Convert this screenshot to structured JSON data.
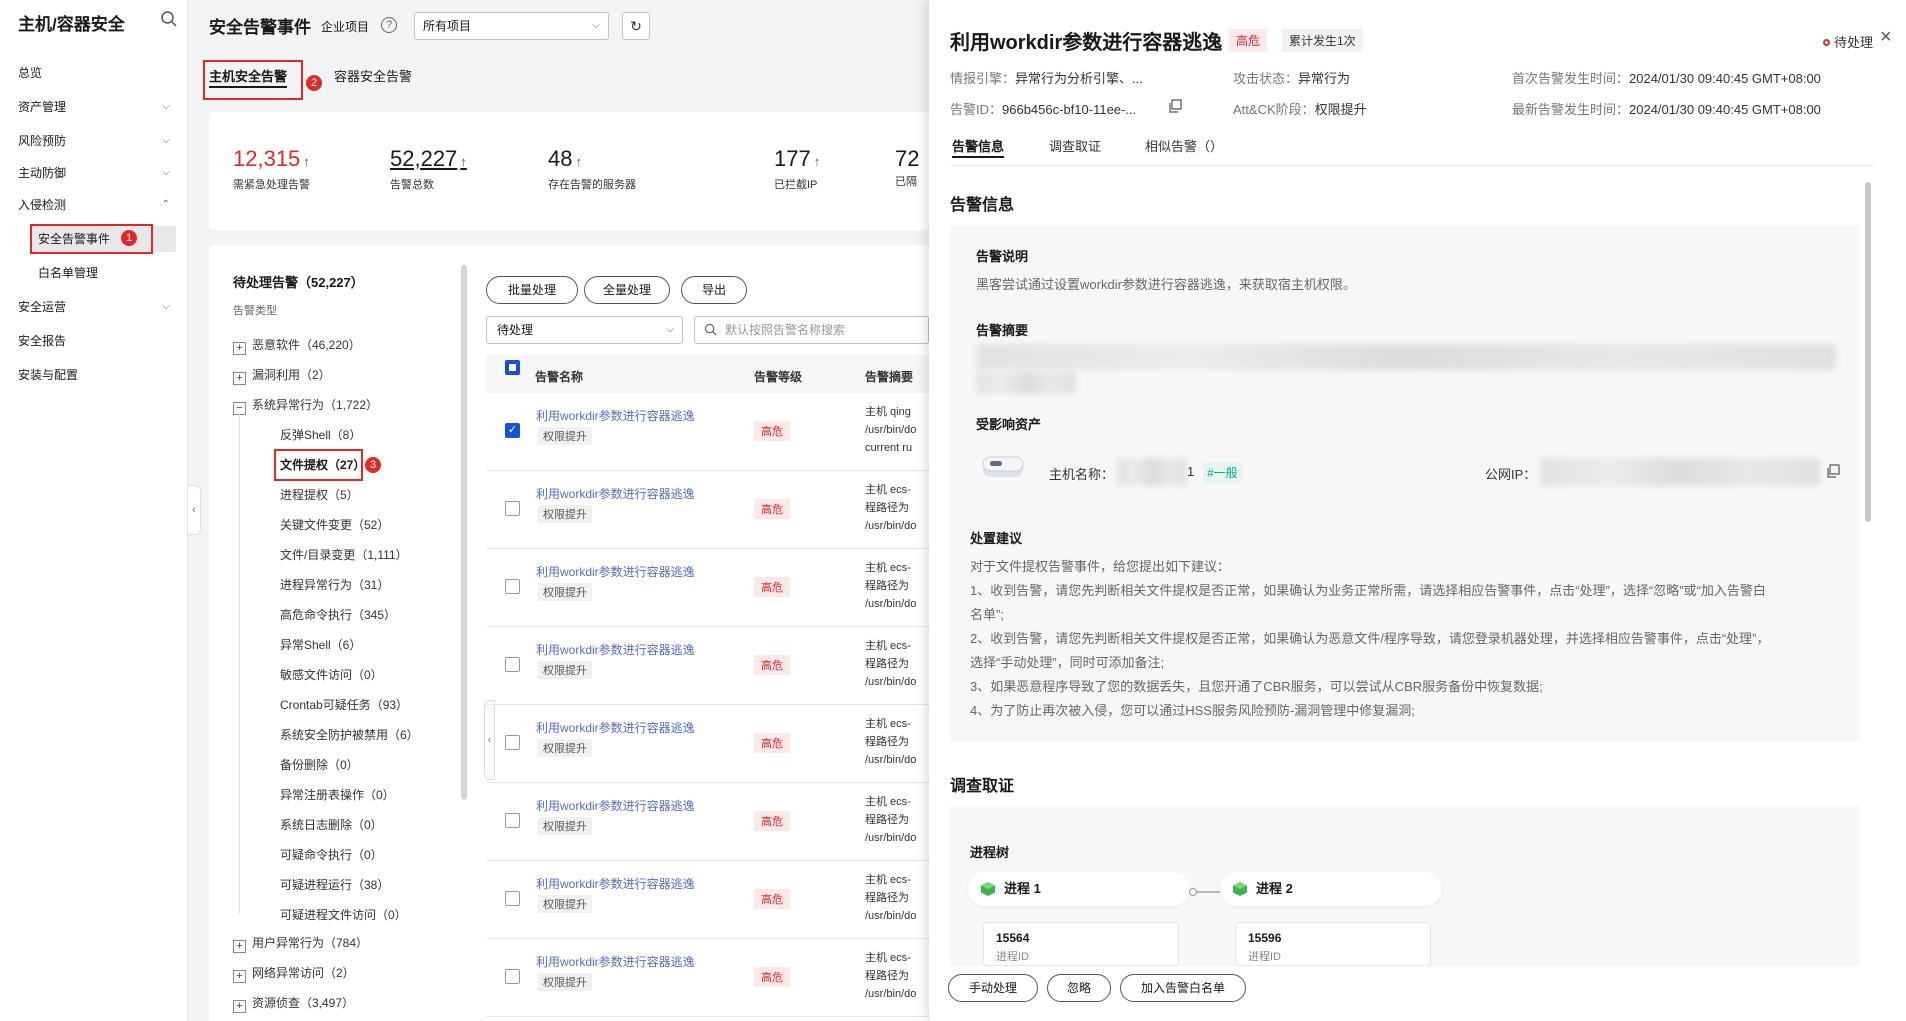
{
  "nav": {
    "title": "主机/容器安全",
    "items": [
      {
        "label": "总览"
      },
      {
        "label": "资产管理"
      },
      {
        "label": "风险预防"
      },
      {
        "label": "主动防御"
      },
      {
        "label": "入侵检测"
      },
      {
        "label": "安全告警事件"
      },
      {
        "label": "白名单管理"
      },
      {
        "label": "安全运营"
      },
      {
        "label": "安全报告"
      },
      {
        "label": "安装与配置"
      }
    ],
    "badges": [
      "1",
      "2",
      "3"
    ]
  },
  "header": {
    "title": "安全告警事件",
    "enterprise_label": "企业项目",
    "project_value": "所有项目"
  },
  "tabs": [
    "主机安全告警",
    "容器安全告警"
  ],
  "stats": [
    {
      "value": "12,315",
      "label": "需紧急处理告警",
      "color": "#e02828"
    },
    {
      "value": "52,227",
      "label": "告警总数"
    },
    {
      "value": "48",
      "label": "存在告警的服务器"
    },
    {
      "value": "177",
      "label": "已拦截IP"
    },
    {
      "value": "72",
      "label": "已隔"
    }
  ],
  "tree": {
    "title": "待处理告警（52,227）",
    "subtitle": "告警类型",
    "groups": [
      {
        "label": "恶意软件（46,220）",
        "expander": "+"
      },
      {
        "label": "漏洞利用（2）",
        "expander": "+"
      },
      {
        "label": "系统异常行为（1,722）",
        "expander": "−"
      }
    ],
    "children": [
      "反弹Shell（8）",
      "文件提权（27）",
      "进程提权（5）",
      "关键文件变更（52）",
      "文件/目录变更（1,111）",
      "进程异常行为（31）",
      "高危命令执行（345）",
      "异常Shell（6）",
      "敏感文件访问（0）",
      "Crontab可疑任务（93）",
      "系统安全防护被禁用（6）",
      "备份删除（0）",
      "异常注册表操作（0）",
      "系统日志删除（0）",
      "可疑命令执行（0）",
      "可疑进程运行（38）",
      "可疑进程文件访问（0）"
    ],
    "groups_after": [
      {
        "label": "用户异常行为（784）",
        "expander": "+"
      },
      {
        "label": "网络异常访问（2）",
        "expander": "+"
      },
      {
        "label": "资源侦查（3,497）",
        "expander": "+"
      }
    ]
  },
  "toolbar": {
    "batch": "批量处理",
    "all": "全量处理",
    "export": "导出",
    "status_value": "待处理",
    "search_placeholder": "默认按照告警名称搜索"
  },
  "table": {
    "headers": [
      "告警名称",
      "告警等级",
      "告警摘要"
    ],
    "rows": [
      {
        "name": "利用workdir参数进行容器逃逸",
        "tag": "权限提升",
        "level": "高危",
        "summary": "主机 qing\n/usr/bin/do\ncurrent ru",
        "checked": true
      },
      {
        "name": "利用workdir参数进行容器逃逸",
        "tag": "权限提升",
        "level": "高危",
        "summary": "主机 ecs-\n程路径为\n/usr/bin/do",
        "checked": false
      },
      {
        "name": "利用workdir参数进行容器逃逸",
        "tag": "权限提升",
        "level": "高危",
        "summary": "主机 ecs-\n程路径为\n/usr/bin/do",
        "checked": false
      },
      {
        "name": "利用workdir参数进行容器逃逸",
        "tag": "权限提升",
        "level": "高危",
        "summary": "主机 ecs-\n程路径为\n/usr/bin/do",
        "checked": false
      },
      {
        "name": "利用workdir参数进行容器逃逸",
        "tag": "权限提升",
        "level": "高危",
        "summary": "主机 ecs-\n程路径为\n/usr/bin/do",
        "checked": false
      },
      {
        "name": "利用workdir参数进行容器逃逸",
        "tag": "权限提升",
        "level": "高危",
        "summary": "主机 ecs-\n程路径为\n/usr/bin/do",
        "checked": false
      },
      {
        "name": "利用workdir参数进行容器逃逸",
        "tag": "权限提升",
        "level": "高危",
        "summary": "主机 ecs-\n程路径为\n/usr/bin/do",
        "checked": false
      },
      {
        "name": "利用workdir参数进行容器逃逸",
        "tag": "权限提升",
        "level": "高危",
        "summary": "主机 ecs-\n程路径为\n/usr/bin/do",
        "checked": false
      }
    ]
  },
  "drawer": {
    "title": "利用workdir参数进行容器逃逸",
    "level": "高危",
    "count": "累计发生1次",
    "status": "待处理",
    "meta": {
      "engine_k": "情报引擎：",
      "engine_v": "异常行为分析引擎、...",
      "attack_k": "攻击状态：",
      "attack_v": "异常行为",
      "first_k": "首次告警发生时间：",
      "first_v": "2024/01/30 09:40:45 GMT+08:00",
      "id_k": "告警ID：",
      "id_v": "966b456c-bf10-11ee-...",
      "stage_k": "Att&CK阶段：",
      "stage_v": "权限提升",
      "latest_k": "最新告警发生时间：",
      "latest_v": "2024/01/30 09:40:45 GMT+08:00"
    },
    "tabs": [
      "告警信息",
      "调查取证",
      "相似告警（）"
    ],
    "info": {
      "section_title": "告警信息",
      "desc_title": "告警说明",
      "desc": "黑客尝试通过设置workdir参数进行容器逃逸，来获取宿主机权限。",
      "summary_title": "告警摘要",
      "asset_title": "受影响资产",
      "host_label": "主机名称：",
      "host_suffix": "1",
      "host_tag": "#一般",
      "ip_label": "公网IP：",
      "advice_title": "处置建议",
      "advice": [
        "对于文件提权告警事件，给您提出如下建议：",
        "1、收到告警，请您先判断相关文件提权是否正常，如果确认为业务正常所需，请选择相应告警事件，点击“处理”，选择“忽略”或“加入告警白",
        "名单”;",
        "2、收到告警，请您先判断相关文件提权是否正常，如果确认为恶意文件/程序导致，请您登录机器处理，并选择相应告警事件，点击“处理”，",
        "选择“手动处理”，同时可添加备注;",
        "3、如果恶意程序导致了您的数据丢失，且您开通了CBR服务，可以尝试从CBR服务备份中恢复数据;",
        "4、为了防止再次被入侵，您可以通过HSS服务风险预防-漏洞管理中修复漏洞;"
      ]
    },
    "forensics": {
      "section_title": "调查取证",
      "tree_title": "进程树",
      "proc1": "进程 1",
      "proc2": "进程 2",
      "pid1": "15564",
      "pid2": "15596",
      "pid_label": "进程ID"
    },
    "footer": {
      "manual": "手动处理",
      "ignore": "忽略",
      "whitelist": "加入告警白名单"
    }
  }
}
